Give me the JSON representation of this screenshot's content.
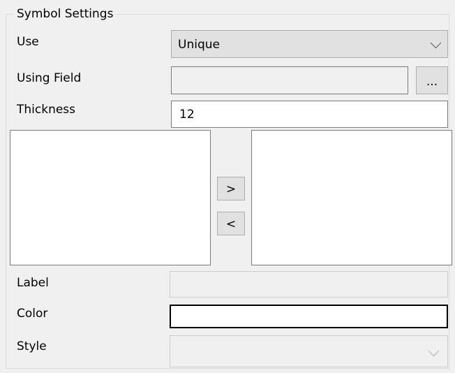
{
  "group": {
    "title": "Symbol Settings"
  },
  "use": {
    "label": "Use",
    "selected": "Unique"
  },
  "using_field": {
    "label": "Using Field",
    "value": "",
    "browse_label": "..."
  },
  "thickness": {
    "label": "Thickness",
    "value": "12"
  },
  "transfer": {
    "add_label": ">",
    "remove_label": "<"
  },
  "label_field": {
    "label": "Label",
    "value": ""
  },
  "color_field": {
    "label": "Color",
    "value": ""
  },
  "style_field": {
    "label": "Style",
    "selected": ""
  },
  "icons": {
    "dropdown": "chevron-down-icon"
  }
}
